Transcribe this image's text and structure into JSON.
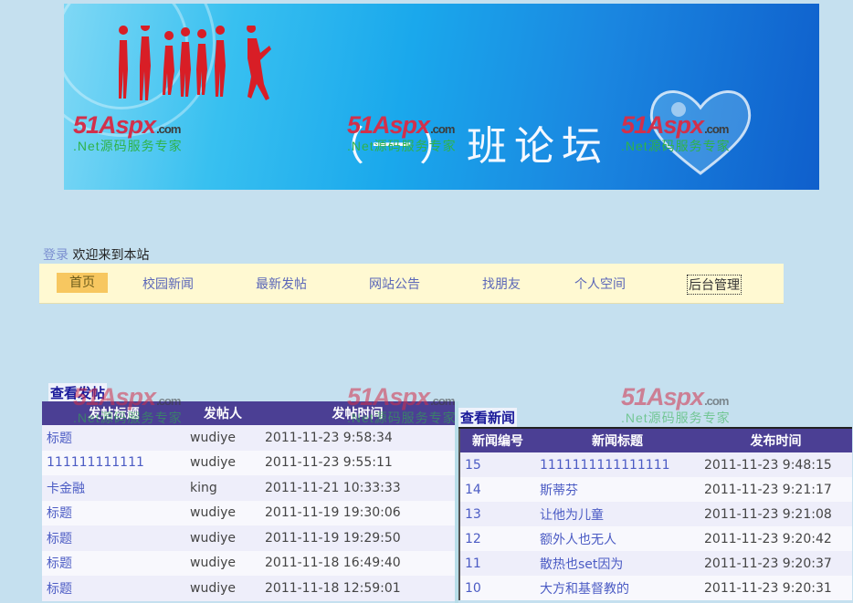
{
  "banner": {
    "title": "（一）班论坛",
    "watermark": {
      "brand": "51Aspx",
      "domain": ".com",
      "slogan": ".Net源码服务专家"
    }
  },
  "login_bar": {
    "login": "登录",
    "welcome": "欢迎来到本站"
  },
  "nav": [
    {
      "label": "首页",
      "active": true
    },
    {
      "label": "校园新闻"
    },
    {
      "label": "最新发帖"
    },
    {
      "label": "网站公告"
    },
    {
      "label": "找朋友"
    },
    {
      "label": "个人空间"
    },
    {
      "label": "后台管理",
      "focused": true
    }
  ],
  "posts": {
    "section_title": "查看发帖",
    "columns": [
      "发帖标题",
      "发帖人",
      "发帖时间"
    ],
    "rows": [
      [
        "标题",
        "wudiye",
        "2011-11-23 9:58:34"
      ],
      [
        "111111111111",
        "wudiye",
        "2011-11-23 9:55:11"
      ],
      [
        "卡金融",
        "king",
        "2011-11-21 10:33:33"
      ],
      [
        "标题",
        "wudiye",
        "2011-11-19 19:30:06"
      ],
      [
        "标题",
        "wudiye",
        "2011-11-19 19:29:50"
      ],
      [
        "标题",
        "wudiye",
        "2011-11-18 16:49:40"
      ],
      [
        "标题",
        "wudiye",
        "2011-11-18 12:59:01"
      ]
    ]
  },
  "news": {
    "section_title": "查看新闻",
    "columns": [
      "新闻编号",
      "新闻标题",
      "发布时间"
    ],
    "rows": [
      [
        "15",
        "1111111111111111",
        "2011-11-23 9:48:15"
      ],
      [
        "14",
        "斯蒂芬",
        "2011-11-23 9:21:17"
      ],
      [
        "13",
        "让他为儿童",
        "2011-11-23 9:21:08"
      ],
      [
        "12",
        "额外人也无人",
        "2011-11-23 9:20:42"
      ],
      [
        "11",
        "散热也set因为",
        "2011-11-23 9:20:37"
      ],
      [
        "10",
        "大方和基督教的",
        "2011-11-23 9:20:31"
      ]
    ]
  },
  "colors": {
    "nav_bg": "#fff9d2",
    "nav_active": "#f7c760",
    "table_header": "#4b3f94",
    "link": "#4b5bc4"
  }
}
